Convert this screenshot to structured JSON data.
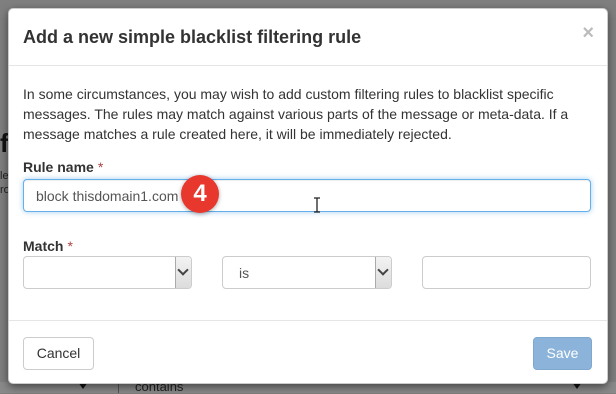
{
  "background": {
    "partial_heading": "fi",
    "partial_text_1": "le",
    "partial_text_2": "ro",
    "bottom_select_value": "contains"
  },
  "modal": {
    "title": "Add a new simple blacklist filtering rule",
    "close_symbol": "×",
    "description": "In some circumstances, you may wish to add custom filtering rules to blacklist specific messages. The rules may match against various parts of the message or meta-data. If a message matches a rule created here, it will be immediately rejected.",
    "rule_name": {
      "label": "Rule name",
      "required_mark": "*",
      "value": "block thisdomain1.com"
    },
    "match": {
      "label": "Match",
      "required_mark": "*",
      "field_select_value": "",
      "operator_select_value": "is",
      "value_input": ""
    },
    "step_badge": "4",
    "footer": {
      "cancel_label": "Cancel",
      "save_label": "Save"
    }
  },
  "colors": {
    "badge": "#e8372c",
    "save_button": "#8cb3d9",
    "focus_border": "#66afe9",
    "required": "#a94442"
  }
}
